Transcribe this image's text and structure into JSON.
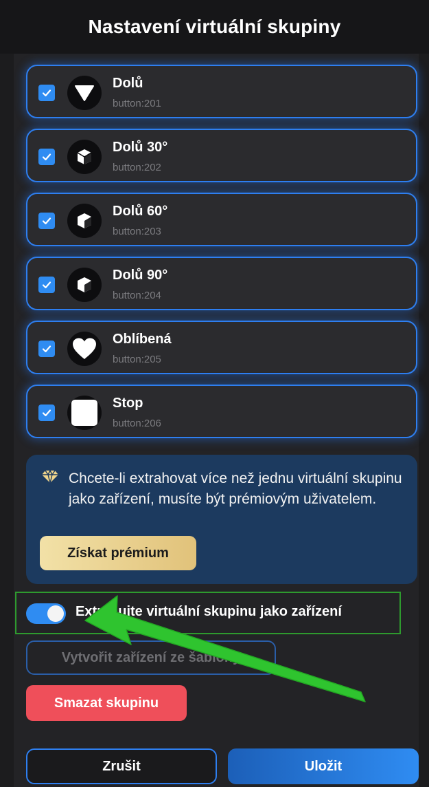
{
  "title": "Nastavení virtuální skupiny",
  "items": [
    {
      "name": "Dolů",
      "id": "button:201",
      "icon": "down-triangle-icon",
      "checked": true
    },
    {
      "name": "Dolů 30°",
      "id": "button:202",
      "icon": "cube-icon",
      "checked": true
    },
    {
      "name": "Dolů 60°",
      "id": "button:203",
      "icon": "cube-icon",
      "checked": true
    },
    {
      "name": "Dolů 90°",
      "id": "button:204",
      "icon": "cube-icon",
      "checked": true
    },
    {
      "name": "Oblíbená",
      "id": "button:205",
      "icon": "heart-icon",
      "checked": true
    },
    {
      "name": "Stop",
      "id": "button:206",
      "icon": "stop-square-icon",
      "checked": true
    }
  ],
  "premium": {
    "message": "Chcete-li extrahovat více než jednu virtuální skupinu jako zařízení, musíte být prémiovým uživatelem.",
    "button_label": "Získat prémium",
    "icon": "diamond-icon"
  },
  "toggle": {
    "label": "Extrahujte virtuální skupinu jako zařízení",
    "on": true
  },
  "template_button_label": "Vytvořit zařízení ze šablony",
  "delete_button_label": "Smazat skupinu",
  "cancel_button_label": "Zrušit",
  "save_button_label": "Uložit",
  "colors": {
    "accent": "#2f8cf2",
    "danger": "#ef4f5a",
    "premium_gold": "#e1c27a",
    "annotation_green": "#2fc42f"
  }
}
